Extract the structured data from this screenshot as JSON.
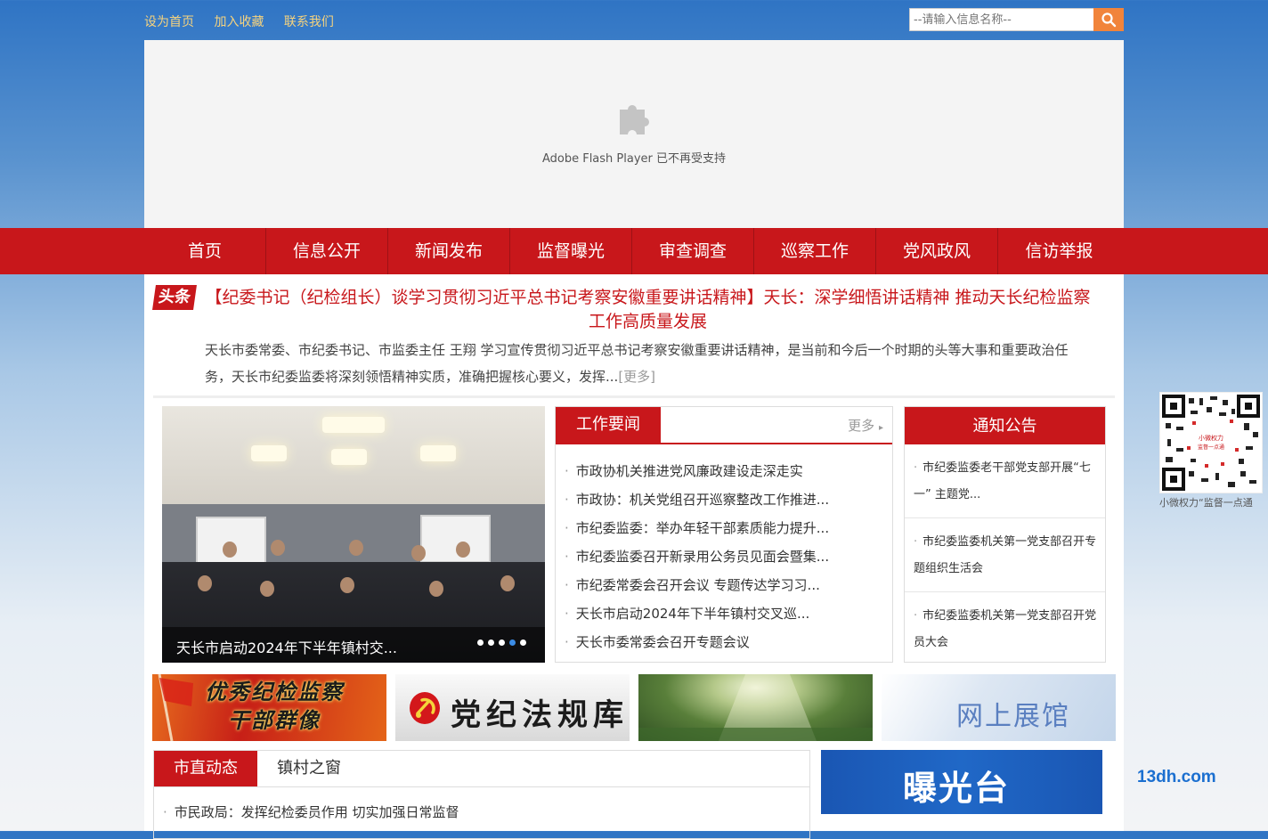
{
  "toplinks": [
    "设为首页",
    "加入收藏",
    "联系我们"
  ],
  "search": {
    "placeholder": "--请输入信息名称--"
  },
  "flash": {
    "text": "Adobe Flash Player 已不再受支持"
  },
  "nav": [
    "首页",
    "信息公开",
    "新闻发布",
    "监督曝光",
    "审查调查",
    "巡察工作",
    "党风政风",
    "信访举报"
  ],
  "headline": {
    "tag": "头条",
    "title": "【纪委书记（纪检组长）谈学习贯彻习近平总书记考察安徽重要讲话精神】天长：深学细悟讲话精神 推动天长纪检监察工作高质量发展",
    "summary": "天长市委常委、市纪委书记、市监委主任 王翔 学习宣传贯彻习近平总书记考察安徽重要讲话精神，是当前和今后一个时期的头等大事和重要政治任务，天长市纪委监委将深刻领悟精神实质，准确把握核心要义，发挥...",
    "more": "[更多]"
  },
  "slider": {
    "caption": "天长市启动2024年下半年镇村交...",
    "dots": 5,
    "active": 4
  },
  "work_news": {
    "title": "工作要闻",
    "more": "更多",
    "items": [
      "市政协机关推进党风廉政建设走深走实",
      "市政协：机关党组召开巡察整改工作推进...",
      "市纪委监委：举办年轻干部素质能力提升...",
      "市纪委监委召开新录用公务员见面会暨集...",
      "市纪委常委会召开会议 专题传达学习习...",
      "天长市启动2024年下半年镇村交叉巡...",
      "天长市委常委会召开专题会议"
    ]
  },
  "notices": {
    "title": "通知公告",
    "items": [
      "市纪委监委老干部党支部开展“七一” 主题党...",
      "市纪委监委机关第一党支部召开专题组织生活会",
      "市纪委监委机关第一党支部召开党员大会"
    ]
  },
  "qr": {
    "caption": "小微权力“监督一点通"
  },
  "banners": {
    "b1": "优秀纪检监察干部群像",
    "b2": "党纪法规库",
    "b4": "网上展馆"
  },
  "bottom": {
    "tabs": [
      "市直动态",
      "镇村之窗"
    ],
    "items": [
      "市民政局：发挥纪检委员作用 切实加强日常监督"
    ]
  },
  "exposure": {
    "title": "曝光台"
  },
  "watermark": "13dh.com",
  "colors": {
    "brand_red": "#c8171b",
    "search_orange": "#f1843b",
    "link_gold": "#f6d37e"
  }
}
